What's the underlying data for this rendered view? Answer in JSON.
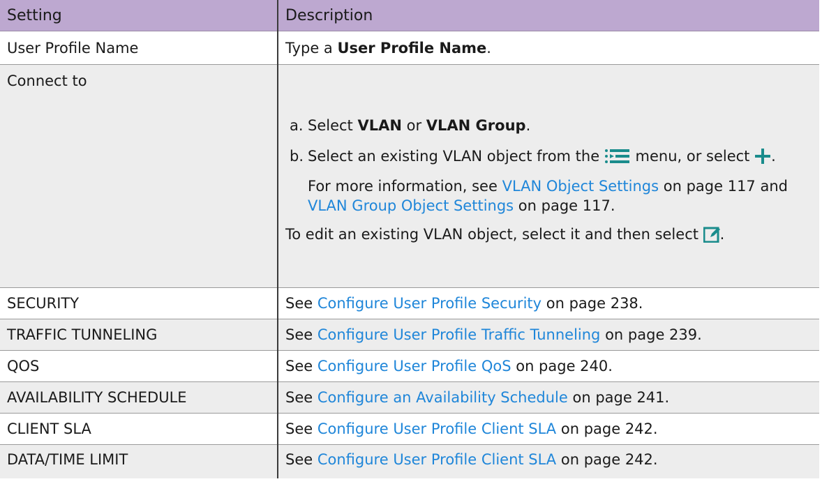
{
  "table": {
    "headers": [
      "Setting",
      "Description"
    ],
    "user_profile_name": {
      "setting": "User Profile Name",
      "desc_prefix": "Type a ",
      "desc_bold": "User Profile Name",
      "desc_suffix": "."
    },
    "connect_to": {
      "setting": "Connect to",
      "step_a_mark": "a.",
      "step_a_text1": "Select ",
      "step_a_bold1": "VLAN",
      "step_a_text2": " or ",
      "step_a_bold2": "VLAN Group",
      "step_a_text3": ".",
      "step_b_mark": "b.",
      "step_b_text1": "Select an existing VLAN object from the ",
      "step_b_text2": " menu, or select ",
      "step_b_text3": ".",
      "note_prefix": "For more information, see ",
      "note_link1": "VLAN Object Settings",
      "note_mid": " on page 117 and ",
      "note_link2": "VLAN Group Object Settings",
      "note_suffix": " on page 117.",
      "edit_text": "To edit an existing VLAN object, select it and then select ",
      "edit_suffix": "."
    },
    "rows": [
      {
        "setting": "SECURITY",
        "prefix": "See ",
        "link": "Configure User Profile Security",
        "suffix": " on page 238."
      },
      {
        "setting": "TRAFFIC TUNNELING",
        "prefix": "See ",
        "link": "Configure User Profile Traffic Tunneling",
        "suffix": " on page 239."
      },
      {
        "setting": "QOS",
        "prefix": "See ",
        "link": "Configure User Profile QoS",
        "suffix": " on page 240."
      },
      {
        "setting": "AVAILABILITY SCHEDULE",
        "prefix": "See ",
        "link": "Configure an Availability Schedule",
        "suffix": " on page 241."
      },
      {
        "setting": "CLIENT SLA",
        "prefix": "See ",
        "link": "Configure User Profile Client SLA",
        "suffix": " on page 242."
      },
      {
        "setting": "DATA/TIME LIMIT",
        "prefix": "See ",
        "link": "Configure User Profile Client SLA",
        "suffix": " on page 242."
      }
    ]
  },
  "icons": {
    "menu": "list-menu-icon",
    "add": "plus-icon",
    "edit": "edit-icon"
  },
  "colors": {
    "header_bg": "#bda8d0",
    "link": "#1f86d9",
    "icon_teal": "#1a8c8c",
    "row_shade": "#ededed"
  }
}
